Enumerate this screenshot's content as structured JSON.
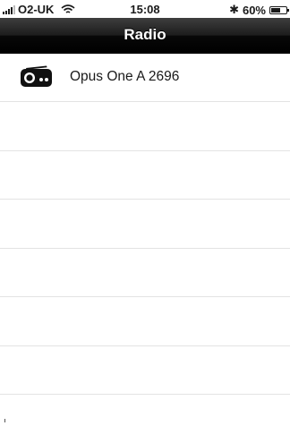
{
  "status_bar": {
    "carrier": "O2-UK",
    "time": "15:08",
    "battery": "60%",
    "battery_level": 0.6
  },
  "nav": {
    "title": "Radio"
  },
  "list": {
    "items": [
      {
        "label": "Opus One A 2696",
        "icon": "radio-icon"
      }
    ]
  }
}
